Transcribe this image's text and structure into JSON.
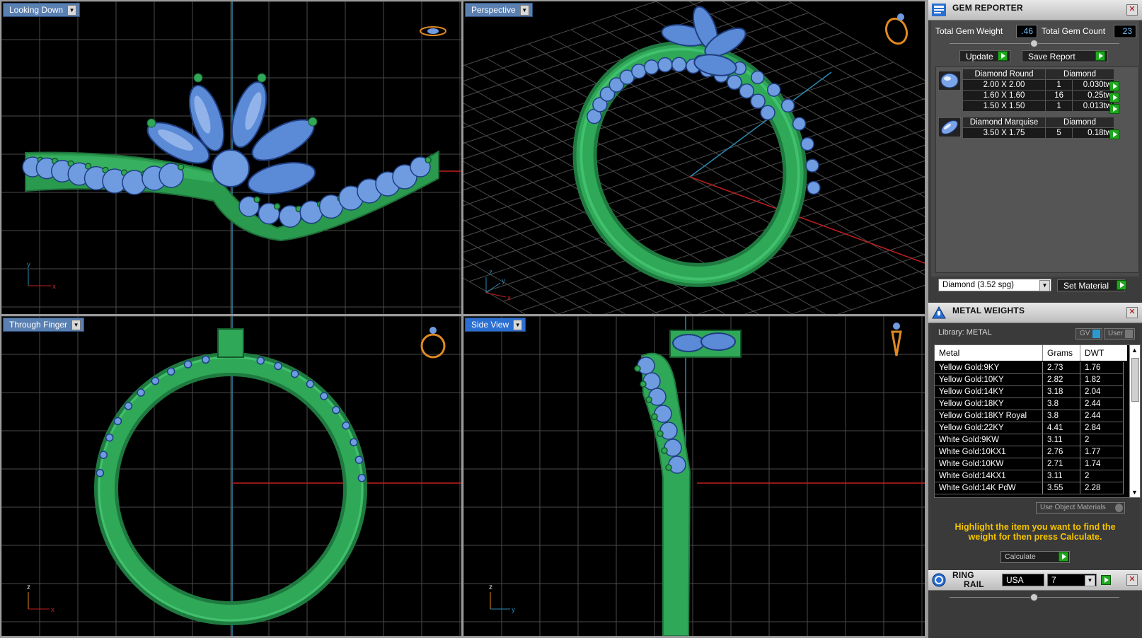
{
  "viewports": {
    "top_left": {
      "label": "Looking Down"
    },
    "top_right": {
      "label": "Perspective"
    },
    "bottom_left": {
      "label": "Through Finger"
    },
    "bottom_right": {
      "label": "Side View"
    }
  },
  "axes": {
    "x": "x",
    "y": "y",
    "z": "z"
  },
  "gem_reporter": {
    "title": "GEM REPORTER",
    "total_gem_weight_label": "Total Gem Weight",
    "total_gem_weight_value": ".46",
    "total_gem_count_label": "Total Gem Count",
    "total_gem_count_value": "23",
    "update_label": "Update",
    "save_report_label": "Save Report",
    "groups": [
      {
        "shape": "Diamond Round",
        "material": "Diamond",
        "rows": [
          {
            "size": "2.00 X 2.00",
            "count": "1",
            "weight": "0.030tw"
          },
          {
            "size": "1.60 X 1.60",
            "count": "16",
            "weight": "0.25tw"
          },
          {
            "size": "1.50 X 1.50",
            "count": "1",
            "weight": "0.013tw"
          }
        ]
      },
      {
        "shape": "Diamond Marquise",
        "material": "Diamond",
        "rows": [
          {
            "size": "3.50 X 1.75",
            "count": "5",
            "weight": "0.18tw"
          }
        ]
      }
    ],
    "material_select": "Diamond    (3.52 spg)",
    "set_material_label": "Set Material"
  },
  "metal_weights": {
    "title": "METAL WEIGHTS",
    "library_label": "Library: METAL",
    "gv_label": "GV",
    "user_label": "User",
    "columns": [
      "Metal",
      "Grams",
      "DWT"
    ],
    "rows": [
      [
        "Yellow Gold:9KY",
        "2.73",
        "1.76"
      ],
      [
        "Yellow Gold:10KY",
        "2.82",
        "1.82"
      ],
      [
        "Yellow Gold:14KY",
        "3.18",
        "2.04"
      ],
      [
        "Yellow Gold:18KY",
        "3.8",
        "2.44"
      ],
      [
        "Yellow Gold:18KY Royal",
        "3.8",
        "2.44"
      ],
      [
        "Yellow Gold:22KY",
        "4.41",
        "2.84"
      ],
      [
        "White Gold:9KW",
        "3.11",
        "2"
      ],
      [
        "White Gold:10KX1",
        "2.76",
        "1.77"
      ],
      [
        "White Gold:10KW",
        "2.71",
        "1.74"
      ],
      [
        "White Gold:14KX1",
        "3.11",
        "2"
      ],
      [
        "White Gold:14K PdW",
        "3.55",
        "2.28"
      ]
    ],
    "use_object_materials": "Use Object Materials",
    "hint": "Highlight the item you want to find the weight for then press Calculate.",
    "calculate_label": "Calculate"
  },
  "ring_rail": {
    "title_line1": "RING",
    "title_line2": "RAIL",
    "country": "USA",
    "size": "7"
  },
  "colors": {
    "ring": "#2fa858",
    "gem": "#6f9be0",
    "grid": "#5a5a5a",
    "viewport_label": "#5a80b2"
  }
}
